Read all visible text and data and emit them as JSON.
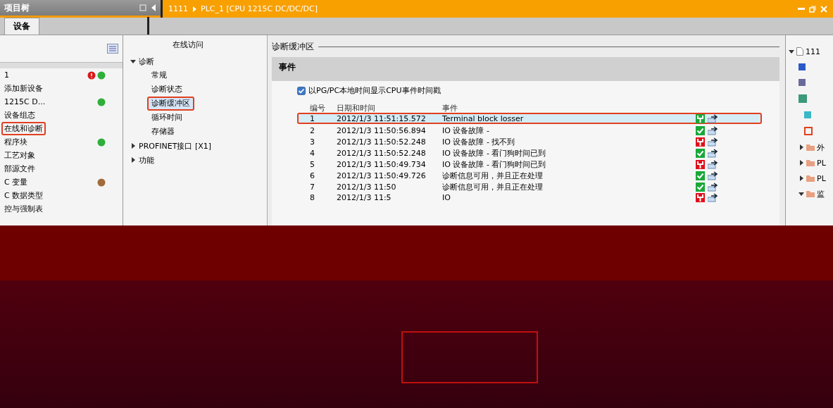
{
  "project_tree": {
    "title": "项目树",
    "tab": "设备",
    "items": [
      {
        "label": "1",
        "error": true,
        "color": "#2fae3a",
        "highlighted": false
      },
      {
        "label": "添加新设备",
        "error": false,
        "highlighted": false
      },
      {
        "label": "1215C D...",
        "error": false,
        "color": "#2fae3a",
        "highlighted": false
      },
      {
        "label": "设备组态",
        "error": false,
        "highlighted": false
      },
      {
        "label": "在线和诊断",
        "error": false,
        "highlighted": true
      },
      {
        "label": "程序块",
        "error": false,
        "color": "#2fae3a",
        "highlighted": false
      },
      {
        "label": "工艺对象",
        "error": false,
        "highlighted": false
      },
      {
        "label": "部源文件",
        "error": false,
        "highlighted": false
      },
      {
        "label": "C 变量",
        "error": false,
        "color": "#a06a3a",
        "highlighted": false
      },
      {
        "label": "C 数据类型",
        "error": false,
        "highlighted": false
      },
      {
        "label": "控与强制表",
        "error": false,
        "highlighted": false
      }
    ]
  },
  "breadcrumb": [
    "1111",
    "PLC_1 [CPU 1215C DC/DC/DC]"
  ],
  "nav": {
    "title": "在线访问",
    "items": [
      {
        "label": "诊断",
        "expanded": true,
        "children": [
          {
            "label": "常规",
            "selected": false,
            "highlighted": false
          },
          {
            "label": "诊断状态",
            "selected": false,
            "highlighted": false
          },
          {
            "label": "诊断缓冲区",
            "selected": true,
            "highlighted": true
          },
          {
            "label": "循环时间",
            "selected": false,
            "highlighted": false
          },
          {
            "label": "存储器",
            "selected": false,
            "highlighted": false
          }
        ]
      },
      {
        "label": "PROFINET接口 [X1]",
        "expanded": false
      },
      {
        "label": "功能",
        "expanded": false
      }
    ]
  },
  "buffer": {
    "title": "诊断缓冲区",
    "section": "事件",
    "local_time": {
      "label": "以PG/PC本地时间显示CPU事件时间戳",
      "checked": true
    },
    "columns": [
      "编号",
      "日期和时间",
      "事件"
    ],
    "rows": [
      {
        "no": "1",
        "time": "2012/1/3 11:51:15.572",
        "event": "Terminal block losser",
        "kind": "wrench",
        "color": "#1aa83a",
        "selected": true,
        "highlighted": true
      },
      {
        "no": "2",
        "time": "2012/1/3 11:50:56.894",
        "event": "IO 设备故障 -",
        "kind": "check",
        "color": "#1aa83a",
        "selected": false,
        "highlighted": false
      },
      {
        "no": "3",
        "time": "2012/1/3 11:50:52.248",
        "event": "IO 设备故障 - 找不到",
        "kind": "wrench",
        "color": "#e0101a",
        "selected": false,
        "highlighted": false
      },
      {
        "no": "4",
        "time": "2012/1/3 11:50:52.248",
        "event": "IO 设备故障 - 看门狗时间已到",
        "kind": "check",
        "color": "#1aa83a",
        "selected": false,
        "highlighted": false
      },
      {
        "no": "5",
        "time": "2012/1/3 11:50:49.734",
        "event": "IO 设备故障 - 看门狗时间已到",
        "kind": "wrench",
        "color": "#e0101a",
        "selected": false,
        "highlighted": false
      },
      {
        "no": "6",
        "time": "2012/1/3 11:50:49.726",
        "event": "诊断信息可用，并且正在处理",
        "kind": "check",
        "color": "#1aa83a",
        "selected": false,
        "highlighted": false
      },
      {
        "no": "7",
        "time": "2012/1/3 11:50",
        "event": "诊断信息可用，并且正在处理",
        "kind": "check",
        "color": "#1aa83a",
        "selected": false,
        "highlighted": false
      },
      {
        "no": "8",
        "time": "2012/1/3 11:5",
        "event": "IO",
        "kind": "wrench",
        "color": "#e0101a",
        "selected": false,
        "highlighted": false
      }
    ]
  },
  "library_tree": {
    "root": {
      "label": "111",
      "expanded": true
    },
    "items": [
      {
        "label": "外",
        "expanded": false
      },
      {
        "label": "PL",
        "expanded": false
      },
      {
        "label": "PL",
        "expanded": false
      },
      {
        "label": "监",
        "expanded": true
      }
    ]
  }
}
